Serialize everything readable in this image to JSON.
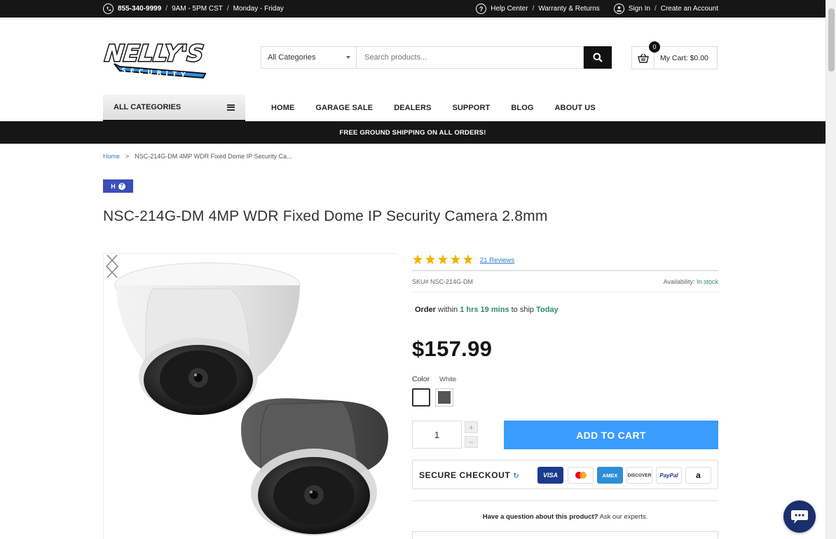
{
  "topbar": {
    "phone": "855-340-9999",
    "hours": "9AM - 5PM CST",
    "days": "Monday - Friday",
    "sep": "/",
    "help": "Help Center",
    "warranty": "Warranty & Returns",
    "signin": "Sign In",
    "create": "Create an Account"
  },
  "logo": {
    "line1": "NELLY'S",
    "line2": "SECURITY"
  },
  "search": {
    "category": "All Categories",
    "placeholder": "Search products..."
  },
  "cart": {
    "count": "0",
    "label": "My Cart: $0.00"
  },
  "nav": {
    "all_categories": "ALL CATEGORIES",
    "items": [
      "HOME",
      "GARAGE SALE",
      "DEALERS",
      "SUPPORT",
      "BLOG",
      "ABOUT US"
    ]
  },
  "shipping_banner": "FREE GROUND SHIPPING ON ALL ORDERS!",
  "breadcrumb": {
    "home": "Home",
    "sep": ">",
    "current": "NSC-214G-DM 4MP WDR Fixed Dome IP Security Ca..."
  },
  "badge": {
    "letter": "H",
    "q": "?"
  },
  "product": {
    "title": "NSC-214G-DM 4MP WDR Fixed Dome IP Security Camera 2.8mm",
    "rating": 5,
    "reviews": "21 Reviews",
    "sku": "SKU# NSC-214G-DM",
    "availability_label": "Availability:",
    "availability_value": "In stock",
    "order_word": "Order",
    "within": "within",
    "time_left": "1 hrs 19 mins",
    "to_ship": "to ship",
    "ship_day": "Today",
    "price": "$157.99",
    "color_label": "Color",
    "color_value": "White",
    "swatches": [
      "white",
      "grey"
    ],
    "quantity": "1",
    "plus": "+",
    "minus": "−",
    "add_to_cart": "ADD TO CART"
  },
  "secure": {
    "label": "SECURE CHECKOUT",
    "payments": {
      "visa": "VISA",
      "amex": "AMEX",
      "discover": "DISCOVER",
      "paypal": "PayPal",
      "amazon": "a"
    }
  },
  "question": {
    "bold": "Have a question about this product?",
    "rest": "Ask our experts."
  },
  "colors": {
    "accent": "#3b9cff",
    "dark": "#161616",
    "link": "#2f7fc4",
    "green": "#2a8f6e",
    "star": "#f5b400",
    "badge": "#3b4db8"
  }
}
